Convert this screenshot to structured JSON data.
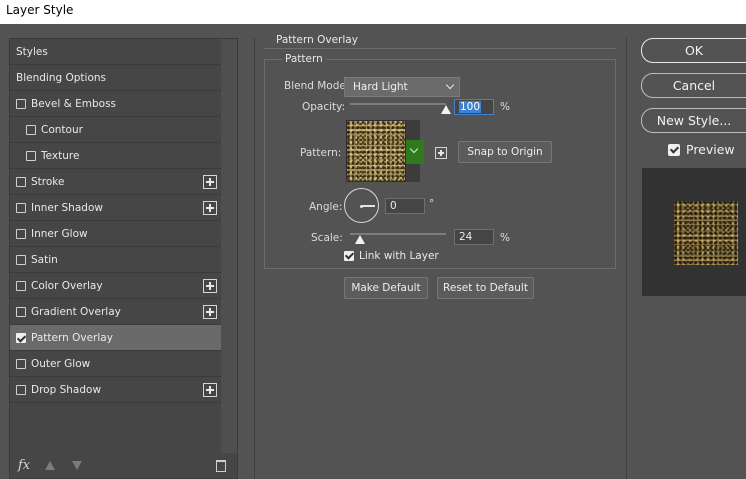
{
  "window": {
    "title": "Layer Style"
  },
  "style_list": {
    "items": [
      {
        "label": "Styles",
        "has_checkbox": false,
        "checked": false,
        "has_plus": false,
        "indent": false,
        "selected": false
      },
      {
        "label": "Blending Options",
        "has_checkbox": false,
        "checked": false,
        "has_plus": false,
        "indent": false,
        "selected": false
      },
      {
        "label": "Bevel & Emboss",
        "has_checkbox": true,
        "checked": false,
        "has_plus": false,
        "indent": false,
        "selected": false
      },
      {
        "label": "Contour",
        "has_checkbox": true,
        "checked": false,
        "has_plus": false,
        "indent": true,
        "selected": false
      },
      {
        "label": "Texture",
        "has_checkbox": true,
        "checked": false,
        "has_plus": false,
        "indent": true,
        "selected": false
      },
      {
        "label": "Stroke",
        "has_checkbox": true,
        "checked": false,
        "has_plus": true,
        "indent": false,
        "selected": false
      },
      {
        "label": "Inner Shadow",
        "has_checkbox": true,
        "checked": false,
        "has_plus": true,
        "indent": false,
        "selected": false
      },
      {
        "label": "Inner Glow",
        "has_checkbox": true,
        "checked": false,
        "has_plus": false,
        "indent": false,
        "selected": false
      },
      {
        "label": "Satin",
        "has_checkbox": true,
        "checked": false,
        "has_plus": false,
        "indent": false,
        "selected": false
      },
      {
        "label": "Color Overlay",
        "has_checkbox": true,
        "checked": false,
        "has_plus": true,
        "indent": false,
        "selected": false
      },
      {
        "label": "Gradient Overlay",
        "has_checkbox": true,
        "checked": false,
        "has_plus": true,
        "indent": false,
        "selected": false
      },
      {
        "label": "Pattern Overlay",
        "has_checkbox": true,
        "checked": true,
        "has_plus": false,
        "indent": false,
        "selected": true
      },
      {
        "label": "Outer Glow",
        "has_checkbox": true,
        "checked": false,
        "has_plus": false,
        "indent": false,
        "selected": false
      },
      {
        "label": "Drop Shadow",
        "has_checkbox": true,
        "checked": false,
        "has_plus": true,
        "indent": false,
        "selected": false
      }
    ],
    "bottom": {
      "fx_label": "fx"
    }
  },
  "panel": {
    "section_title": "Pattern Overlay",
    "group_title": "Pattern",
    "blend_mode": {
      "label": "Blend Mode:",
      "value": "Hard Light"
    },
    "opacity": {
      "label": "Opacity:",
      "value": "100",
      "unit": "%",
      "slider_fraction": 1.0
    },
    "pattern": {
      "label": "Pattern:",
      "snap_button": "Snap to Origin"
    },
    "angle": {
      "label": "Angle:",
      "value": "0",
      "unit": "°"
    },
    "scale": {
      "label": "Scale:",
      "value": "24",
      "unit": "%",
      "slider_fraction": 0.1
    },
    "link_with_layer": {
      "label": "Link with Layer",
      "checked": true
    },
    "make_default": "Make Default",
    "reset_default": "Reset to Default"
  },
  "right": {
    "ok": "OK",
    "cancel": "Cancel",
    "new_style": "New Style...",
    "preview": {
      "label": "Preview",
      "checked": true
    }
  },
  "colors": {
    "dialog_bg": "#535353",
    "selected_row": "#6a6a6a",
    "focus_blue": "#3f82d0",
    "pattern_dropdown_green": "#2f7a1c"
  }
}
